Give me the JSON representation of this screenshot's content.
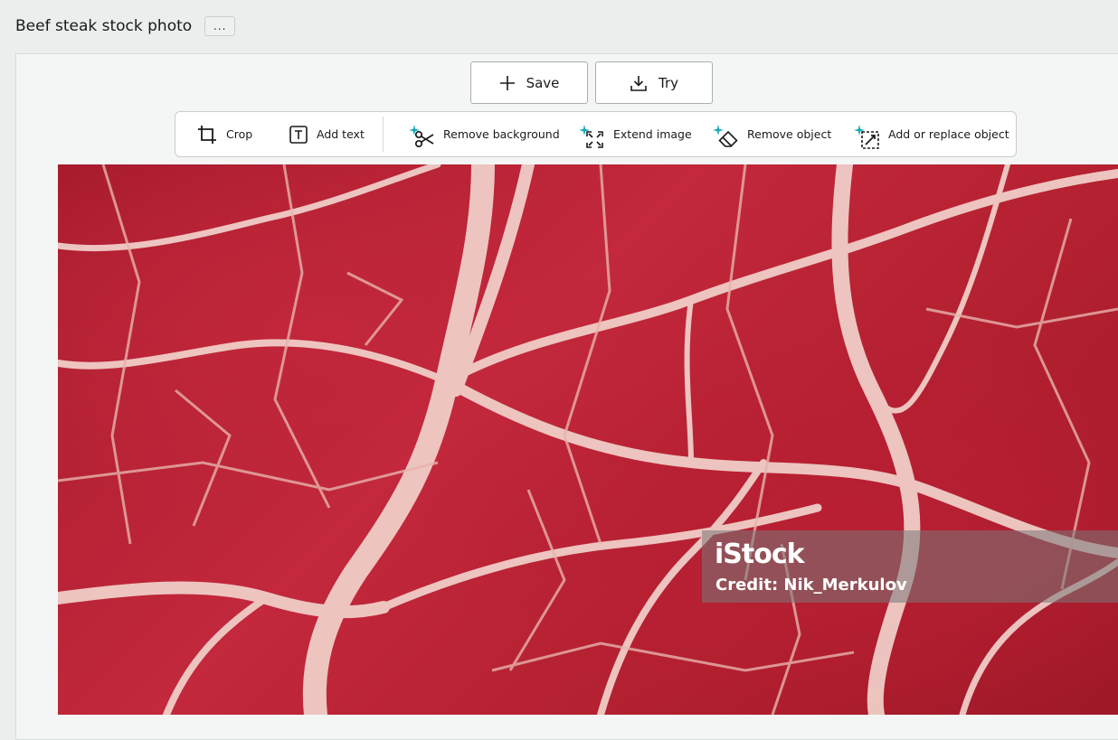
{
  "header": {
    "title": "Beef steak stock photo",
    "more_label": "..."
  },
  "actions": {
    "save_label": "Save",
    "try_label": "Try"
  },
  "toolbar": {
    "crop": "Crop",
    "add_text": "Add text",
    "remove_background": "Remove background",
    "extend_image": "Extend image",
    "remove_object": "Remove object",
    "add_replace_object": "Add or replace object"
  },
  "image": {
    "watermark_logo": "iStock",
    "watermark_credit": "Credit: Nik_Merkulov"
  },
  "colors": {
    "sparkle": "#17a9b8",
    "meat_red": "#b8213a",
    "fat": "#f3d6cf"
  }
}
